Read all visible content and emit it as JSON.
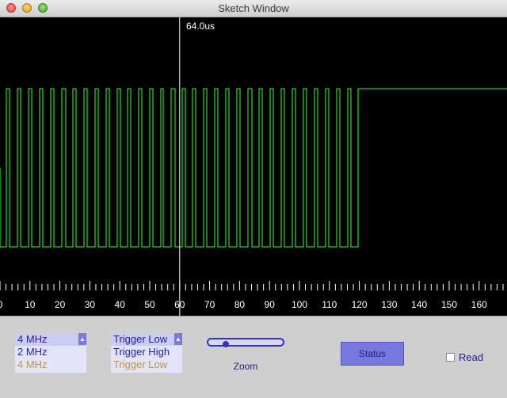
{
  "window": {
    "title": "Sketch Window"
  },
  "scope": {
    "cursor_readout": "64.0us",
    "cursor_time": 60,
    "trace_color": "#33ff33",
    "axis_ticks": [
      "0",
      "10",
      "20",
      "30",
      "40",
      "50",
      "60",
      "70",
      "80",
      "90",
      "100",
      "110",
      "120",
      "130",
      "140",
      "150",
      "160"
    ]
  },
  "controls": {
    "frequency": {
      "selected": "4 MHz",
      "options": [
        "2 MHz",
        "4 MHz"
      ]
    },
    "trigger": {
      "selected": "Trigger Low",
      "options": [
        "Trigger High",
        "Trigger Low"
      ]
    },
    "zoom": {
      "label": "Zoom",
      "level": 0.18
    },
    "status_label": "Status",
    "read_label": "Read",
    "read_checked": false
  }
}
